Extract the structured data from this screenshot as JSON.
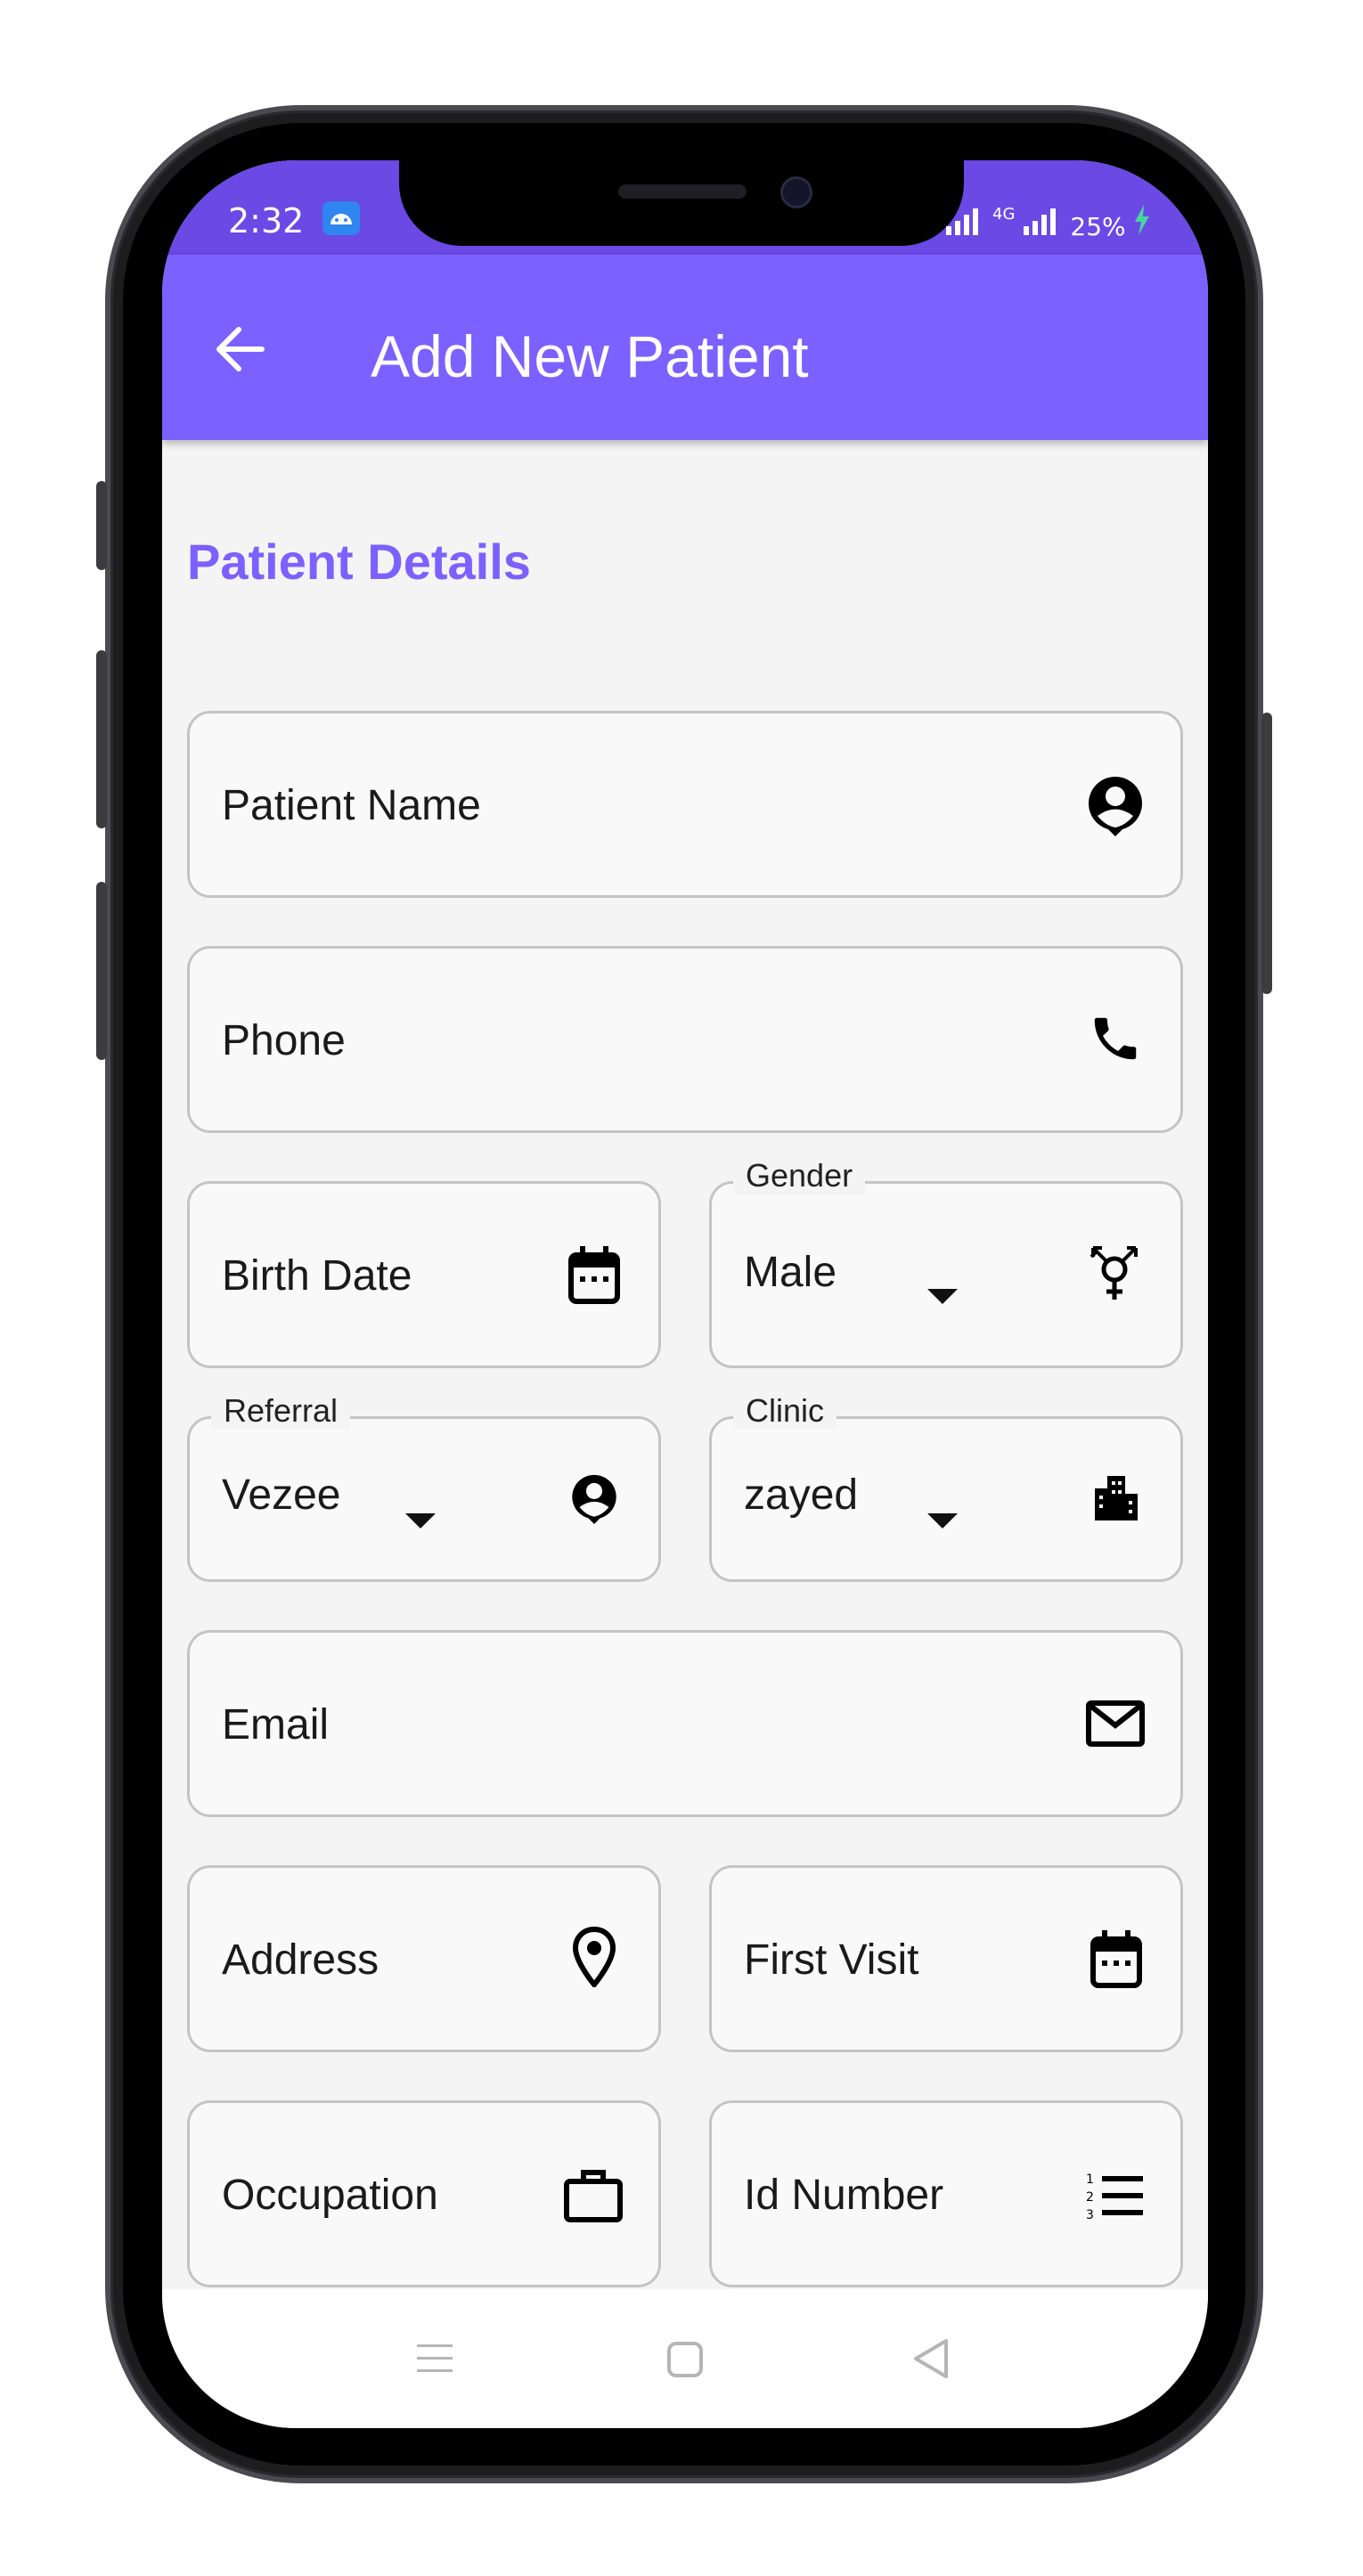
{
  "status_bar": {
    "time": "2:32",
    "network": "4G",
    "battery": "25%"
  },
  "app_bar": {
    "title": "Add New Patient"
  },
  "form": {
    "section_title": "Patient Details",
    "patient_name": "Patient Name",
    "phone": "Phone",
    "birth_date": "Birth Date",
    "gender": {
      "label": "Gender",
      "value": "Male"
    },
    "referral": {
      "label": "Referral",
      "value": "Vezee"
    },
    "clinic": {
      "label": "Clinic",
      "value": "zayed"
    },
    "email": "Email",
    "address": "Address",
    "first_visit": "First Visit",
    "occupation": "Occupation",
    "id_number": "Id Number"
  },
  "colors": {
    "app_bar": "#7b61ff",
    "status_bar": "#6a49e5",
    "accent": "#7b61ff",
    "field_border": "#c4c4c4"
  },
  "icons": [
    "arrow-left",
    "account-circle",
    "phone",
    "calendar",
    "gender",
    "city",
    "email",
    "location-pin",
    "briefcase",
    "numbered-list",
    "menu",
    "square",
    "triangle-back"
  ]
}
